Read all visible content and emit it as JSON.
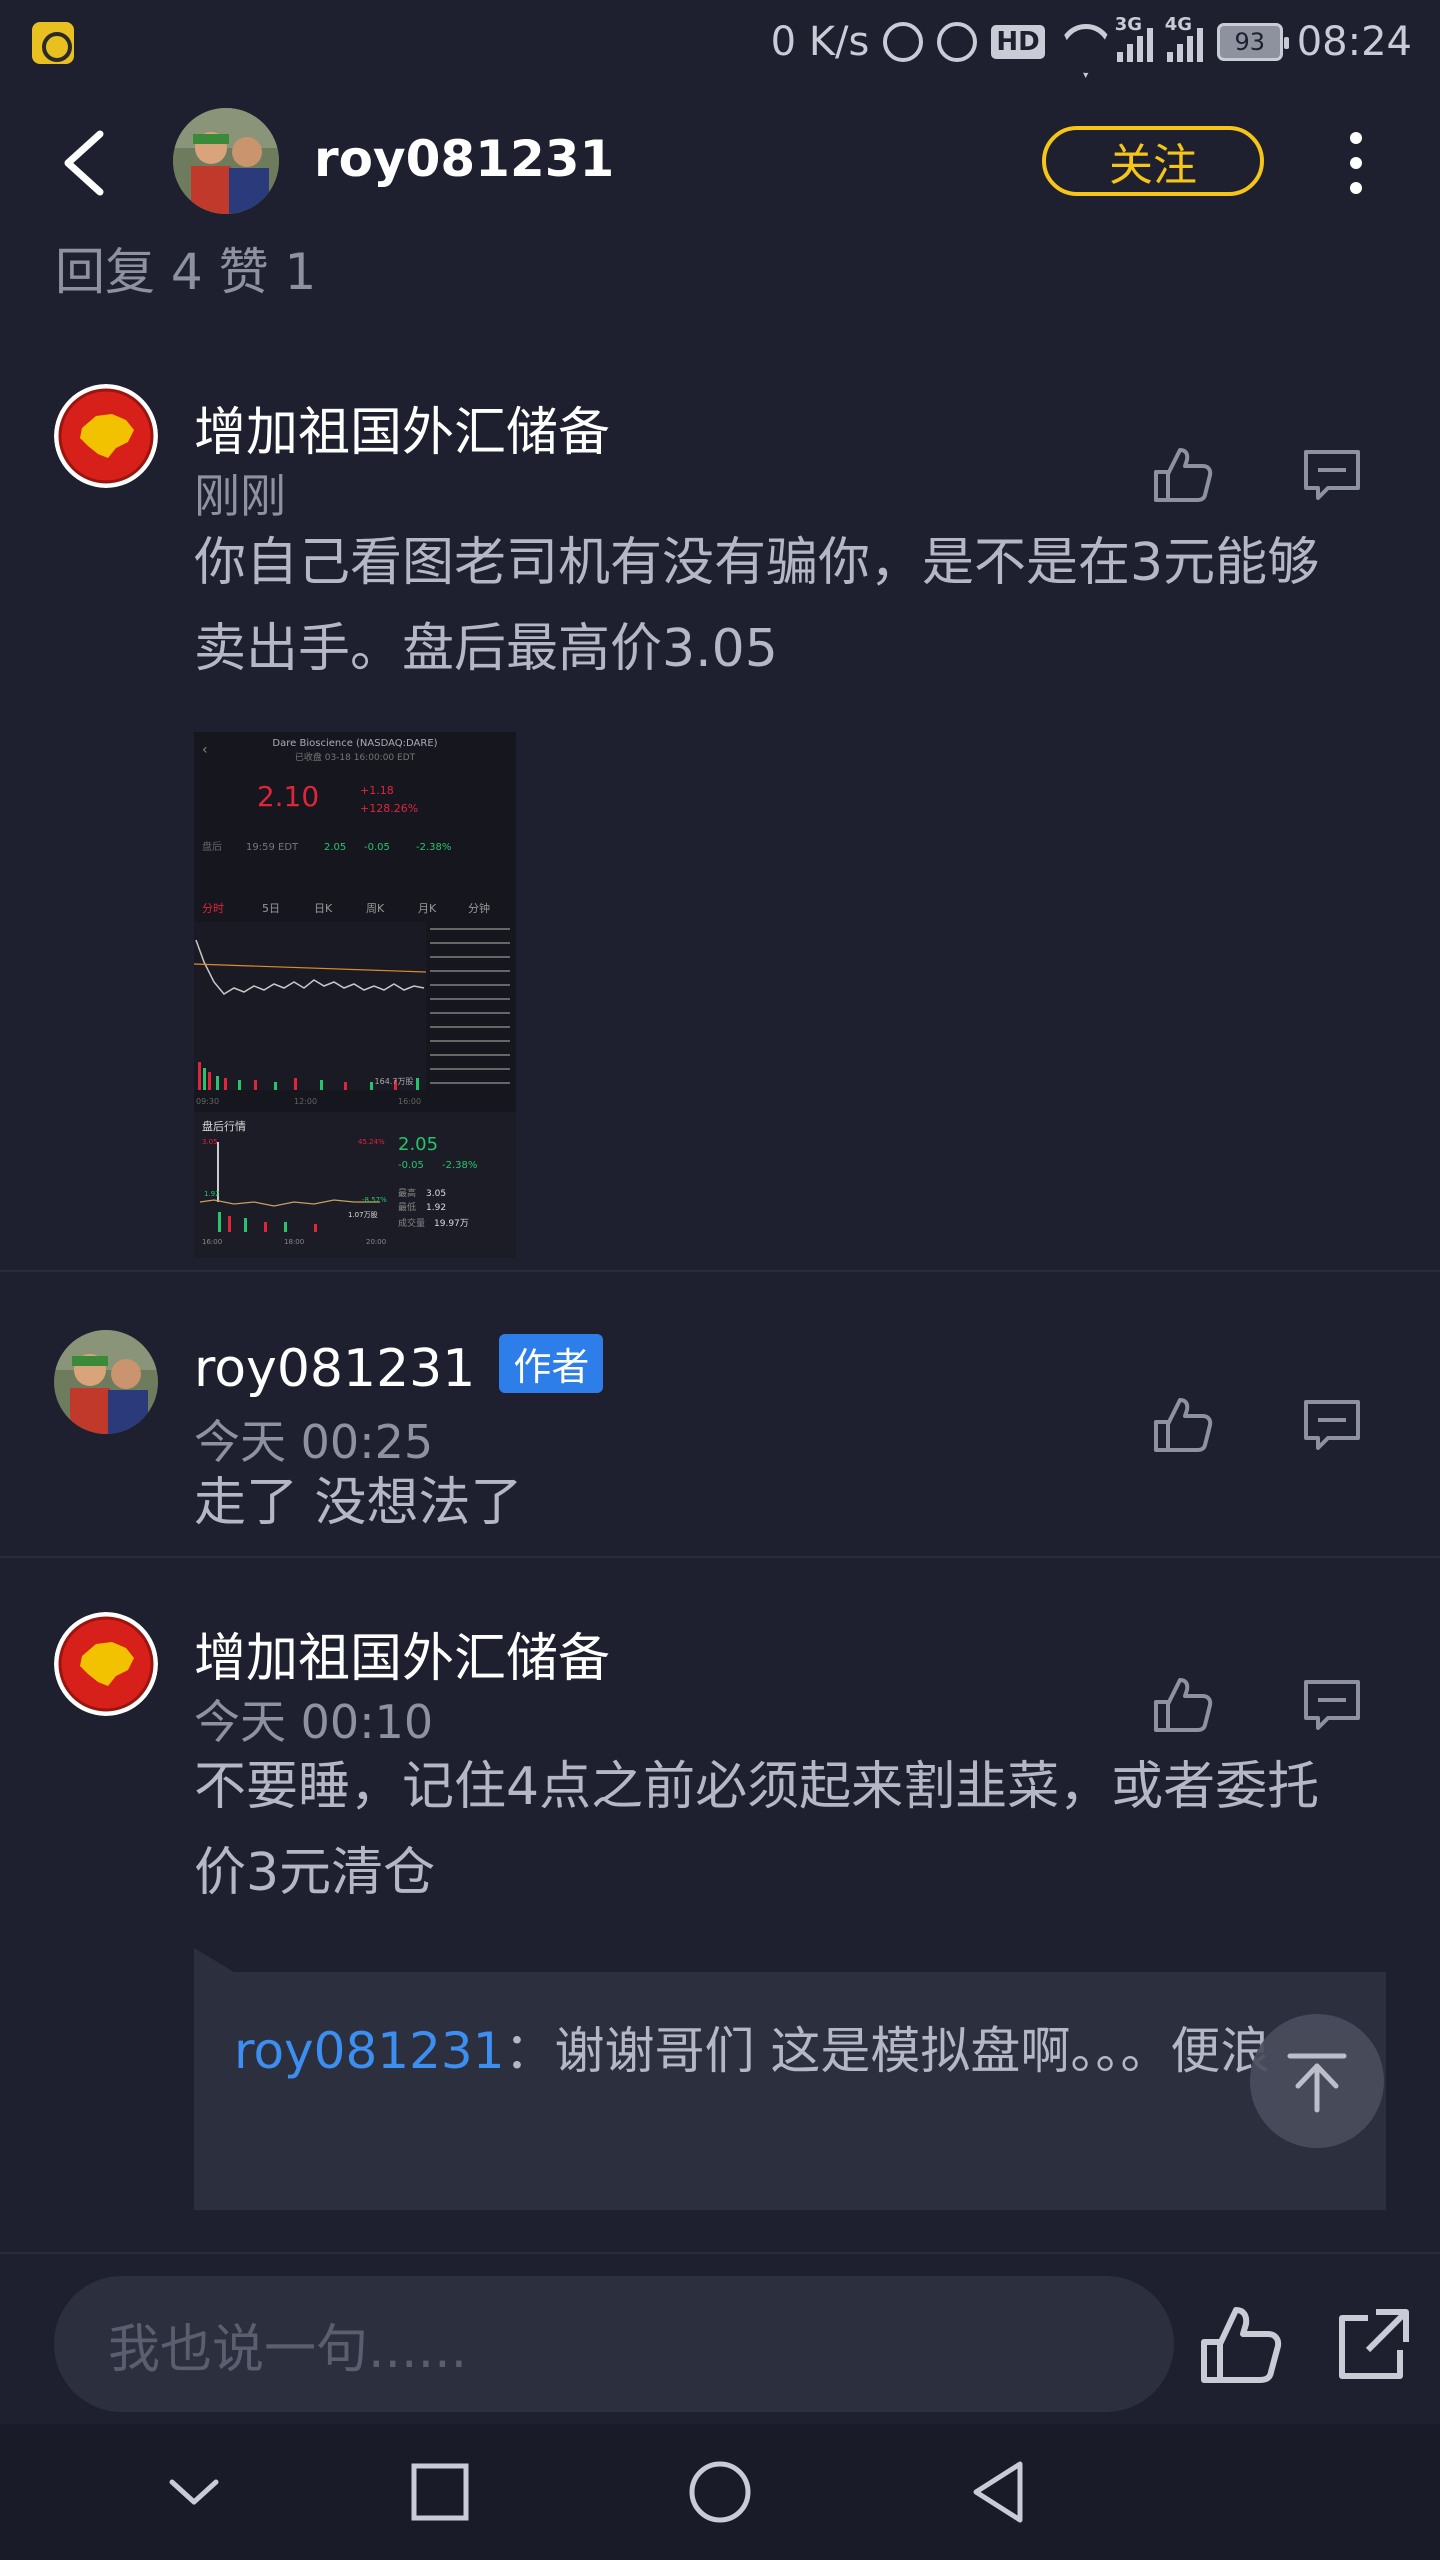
{
  "status_bar": {
    "net_speed": "0 K/s",
    "hd": "HD",
    "net_3g": "3G",
    "net_4g": "4G",
    "battery": "93",
    "time": "08:24"
  },
  "header": {
    "username": "roy081231",
    "follow_label": "关注"
  },
  "stats": "回复 4 赞 1",
  "comments": [
    {
      "name": "增加祖国外汇储备",
      "time": "刚刚",
      "text": "你自己看图老司机有没有骗你，是不是在3元能够卖出手。盘后最高价3.05"
    },
    {
      "name": "roy081231",
      "author_tag": "作者",
      "time": "今天 00:25",
      "text": "走了 没想法了"
    },
    {
      "name": "增加祖国外汇储备",
      "time": "今天 00:10",
      "text": "不要睡，记住4点之前必须起来割韭菜，或者委托价3元清仓",
      "quote": {
        "user": "roy081231",
        "sep": "：",
        "text": "谢谢哥们 这是模拟盘啊。。。便浪"
      }
    }
  ],
  "thumbnail": {
    "title": "Dare Bioscience (NASDAQ:DARE)",
    "subtitle": "已收盘 03-18 16:00:00 EDT",
    "price": "2.10",
    "change": "+1.18",
    "change_pct": "+128.26%",
    "after_label": "盘后",
    "after_time": "19:59 EDT",
    "after_price": "2.05",
    "after_change": "-0.05",
    "after_pct": "-2.38%",
    "tabs": [
      "分时",
      "5日",
      "日K",
      "周K",
      "月K",
      "分钟"
    ],
    "volume_label": "164.7万股",
    "times": [
      "09:30",
      "12:00",
      "16:00"
    ],
    "post_title": "盘后行情",
    "post_price": "2.05",
    "post_change": "-0.05",
    "post_pct": "-2.38%",
    "post_high_label": "最高",
    "post_high": "3.05",
    "post_low_label": "最低",
    "post_low": "1.92",
    "post_vol_label": "成交量",
    "post_vol": "19.97万",
    "post_hi_mark": "3.05",
    "post_hi_pct": "45.24%",
    "post_lo_mark": "1.92",
    "post_lo_pct": "-8.57%",
    "post_vol_mark": "1.07万股",
    "post_times": [
      "16:00",
      "18:00",
      "20:00"
    ]
  },
  "input": {
    "placeholder": "我也说一句......"
  },
  "colors": {
    "background": "#1e2030",
    "accent_follow": "#f5c518",
    "author_tag": "#2d7ee8",
    "quote_user": "#3c8ef0"
  }
}
